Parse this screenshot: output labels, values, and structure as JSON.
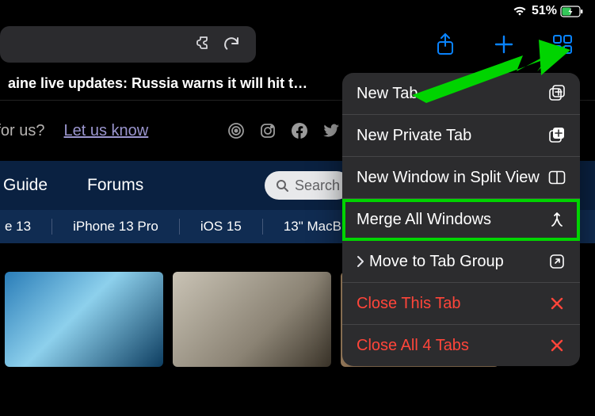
{
  "status": {
    "battery_pct": "51%"
  },
  "page": {
    "headline": "aine live updates: Russia warns it will hit t…",
    "tip_text": "a tip for us?",
    "tip_link": "Let us know",
    "nav": {
      "guide": "Guide",
      "forums": "Forums"
    },
    "search_placeholder": "Search",
    "tags": [
      "e 13",
      "iPhone 13 Pro",
      "iOS 15",
      "13\" MacB"
    ]
  },
  "menu": {
    "new_tab": "New Tab",
    "new_private_tab": "New Private Tab",
    "new_window_split": "New Window in Split View",
    "merge_all": "Merge All Windows",
    "move_to_group": "Move to Tab Group",
    "close_this": "Close This Tab",
    "close_all": "Close All 4 Tabs"
  }
}
